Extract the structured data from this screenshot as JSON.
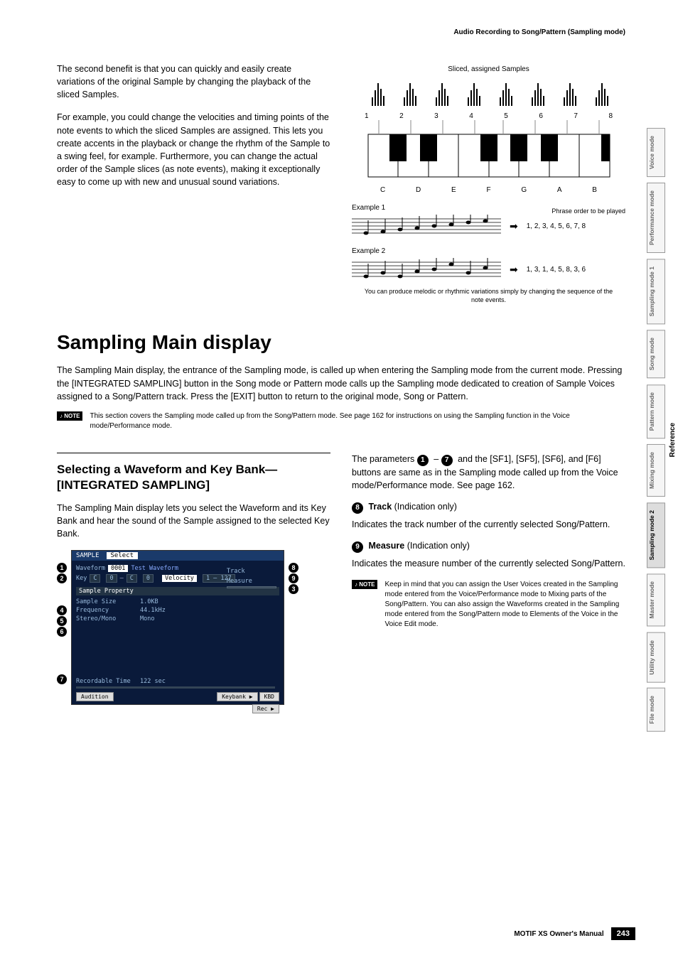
{
  "header": {
    "breadcrumb": "Audio Recording to Song/Pattern (Sampling mode)"
  },
  "top_left": {
    "para1": "The second benefit is that you can quickly and easily create variations of the original Sample by changing the playback of the sliced Samples.",
    "para2": "For example, you could change the velocities and timing points of the note events to which the sliced Samples are assigned. This lets you create accents in the playback or change the rhythm of the Sample to a swing feel, for example. Furthermore, you can change the actual order of the Sample slices (as note events), making it exceptionally easy to come up with new and unusual sound variations."
  },
  "diagram": {
    "title": "Sliced, assigned Samples",
    "slice_nums": [
      "1",
      "2",
      "3",
      "4",
      "5",
      "6",
      "7",
      "8"
    ],
    "notes": [
      "C",
      "D",
      "E",
      "F",
      "G",
      "A",
      "B"
    ],
    "phrase_label": "Phrase order to be played",
    "example1_title": "Example 1",
    "example1_order": "1, 2, 3, 4, 5, 6, 7, 8",
    "example2_title": "Example 2",
    "example2_order": "1, 3, 1, 4, 5, 8, 3, 6",
    "caption": "You can produce melodic or rhythmic variations simply by changing the sequence of the note events."
  },
  "main_section": {
    "title": "Sampling Main display",
    "intro": "The Sampling Main display, the entrance of the Sampling mode, is called up when entering the Sampling mode from the current mode. Pressing the [INTEGRATED SAMPLING] button in the Song mode or Pattern mode calls up the Sampling mode dedicated to creation of Sample Voices assigned to a Song/Pattern track. Press the [EXIT] button to return to the original mode, Song or Pattern.",
    "note": "This section covers the Sampling mode called up from the Song/Pattern mode. See page 162 for instructions on using the Sampling function in the Voice mode/Performance mode."
  },
  "lower_left": {
    "subtitle": "Selecting a Waveform and Key Bank—[INTEGRATED SAMPLING]",
    "para": "The Sampling Main display lets you select the Waveform and its Key Bank and hear the sound of the Sample assigned to the selected Key Bank."
  },
  "screenshot": {
    "header_left": "SAMPLE",
    "header_right": "Select",
    "waveform_label": "Waveform",
    "waveform_num": "0001",
    "waveform_name": "Test Waveform",
    "key_label": "Key",
    "key_vals": [
      "C",
      "0",
      "–",
      "C",
      "0"
    ],
    "velocity_label": "Velocity",
    "velocity_val": "1 – 127",
    "track_label": "Track",
    "measure_label": "Measure",
    "section_title": "Sample Property",
    "props": [
      {
        "label": "Sample Size",
        "val": "1.0KB"
      },
      {
        "label": "Frequency",
        "val": "44.1kHz"
      },
      {
        "label": "Stereo/Mono",
        "val": "Mono"
      }
    ],
    "rec_time_label": "Recordable Time",
    "rec_time_val": "122 sec",
    "btn_audition": "Audition",
    "btn_keybank": "Keybank ▶",
    "btn_kbd": "KBD",
    "btn_rec": "Rec ▶"
  },
  "lower_right": {
    "intro": "The parameters ① – ⑦ and the [SF1], [SF5], [SF6], and [F6] buttons are same as in the Sampling mode called up from the Voice mode/Performance mode. See page 162.",
    "param8_num": "8",
    "param8_name": "Track",
    "param8_hint": "(Indication only)",
    "param8_body": "Indicates the track number of the currently selected Song/Pattern.",
    "param9_num": "9",
    "param9_name": "Measure",
    "param9_hint": "(Indication only)",
    "param9_body": "Indicates the measure number of the currently selected Song/Pattern.",
    "note": "Keep in mind that you can assign the User Voices created in the Sampling mode entered from the Voice/Performance mode to Mixing parts of the Song/Pattern. You can also assign the Waveforms created in the Sampling mode entered from the Song/Pattern mode to Elements of the Voice in the Voice Edit mode."
  },
  "side_tabs": [
    "Voice mode",
    "Performance mode",
    "Sampling mode 1",
    "Song mode",
    "Pattern mode",
    "Mixing mode",
    "Sampling mode 2",
    "Master mode",
    "Utility mode",
    "File mode"
  ],
  "reference": "Reference",
  "footer": {
    "manual": "MOTIF XS Owner's Manual",
    "page": "243"
  }
}
